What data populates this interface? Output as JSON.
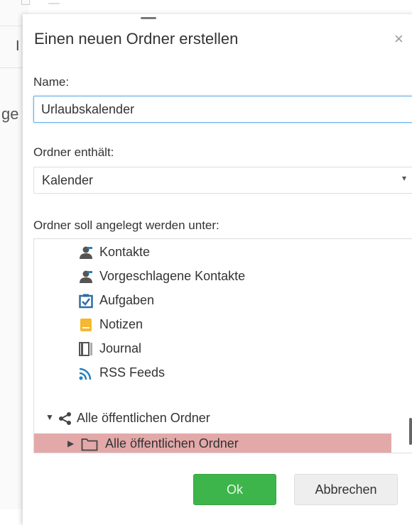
{
  "background": {
    "fragment_top": "I",
    "fragment_mid": "ge"
  },
  "dialog": {
    "title": "Einen neuen Ordner erstellen",
    "close_glyph": "×",
    "name_label": "Name:",
    "name_value": "Urlaubskalender",
    "contains_label": "Ordner enthält:",
    "contains_value": "Kalender",
    "parent_label": "Ordner soll angelegt werden unter:",
    "tree": {
      "items": [
        {
          "label": "Kontakte",
          "icon": "contacts-icon"
        },
        {
          "label": "Vorgeschlagene Kontakte",
          "icon": "suggested-contacts-icon"
        },
        {
          "label": "Aufgaben",
          "icon": "tasks-icon"
        },
        {
          "label": "Notizen",
          "icon": "notes-icon"
        },
        {
          "label": "Journal",
          "icon": "journal-icon"
        },
        {
          "label": "RSS Feeds",
          "icon": "rss-icon"
        }
      ],
      "public_root": "Alle öffentlichen Ordner",
      "public_child": "Alle öffentlichen Ordner"
    },
    "ok_label": "Ok",
    "cancel_label": "Abbrechen"
  },
  "colors": {
    "ok_button": "#3db54a",
    "selected_row": "#e3a9a9",
    "input_focus": "#66afe9",
    "contact_icon": "#555555",
    "task_icon": "#2e6da4",
    "notes_icon": "#f5b82e",
    "rss_icon": "#2a7fbd"
  }
}
